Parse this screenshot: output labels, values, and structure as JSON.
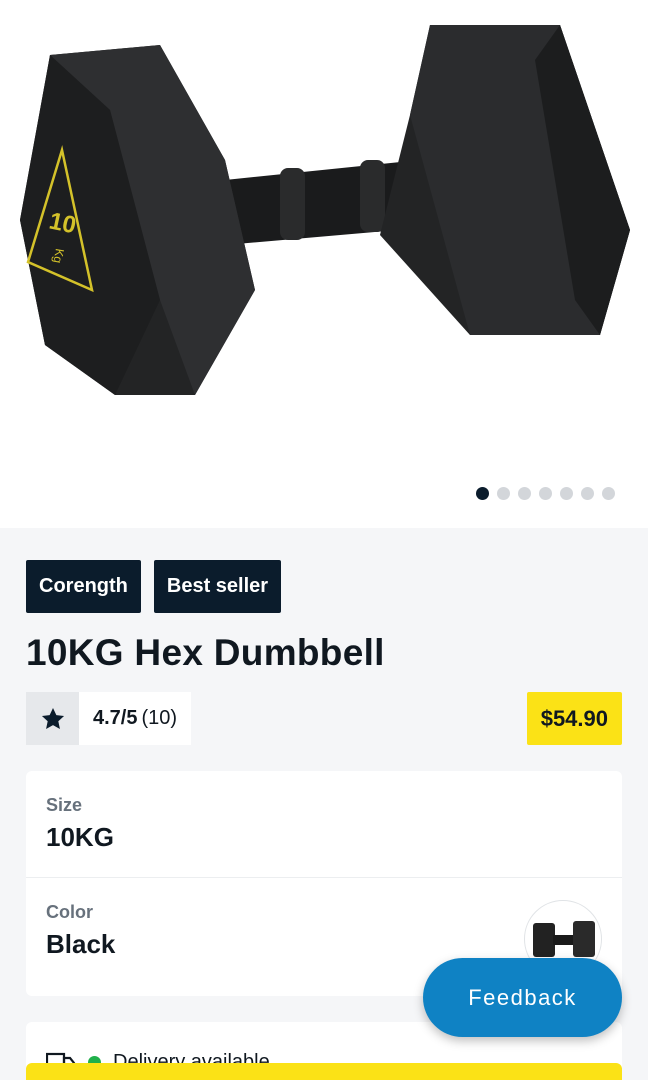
{
  "gallery": {
    "image_alt": "10KG Hex Dumbbell",
    "weight_marking": "10",
    "unit_marking": "Kg",
    "dot_count": 7,
    "active_dot": 0
  },
  "tags": [
    "Corength",
    "Best seller"
  ],
  "product": {
    "title": "10KG Hex Dumbbell",
    "rating_score": "4.7/5",
    "rating_count": "(10)",
    "price": "$54.90"
  },
  "options": {
    "size_label": "Size",
    "size_value": "10KG",
    "color_label": "Color",
    "color_value": "Black"
  },
  "delivery": {
    "text": "Delivery available"
  },
  "feedback_button": "Feedback",
  "colors": {
    "brand_dark": "#0b1c2c",
    "price_yellow": "#fbe216",
    "feedback_blue": "#0f82c4",
    "available_green": "#20b04b"
  }
}
